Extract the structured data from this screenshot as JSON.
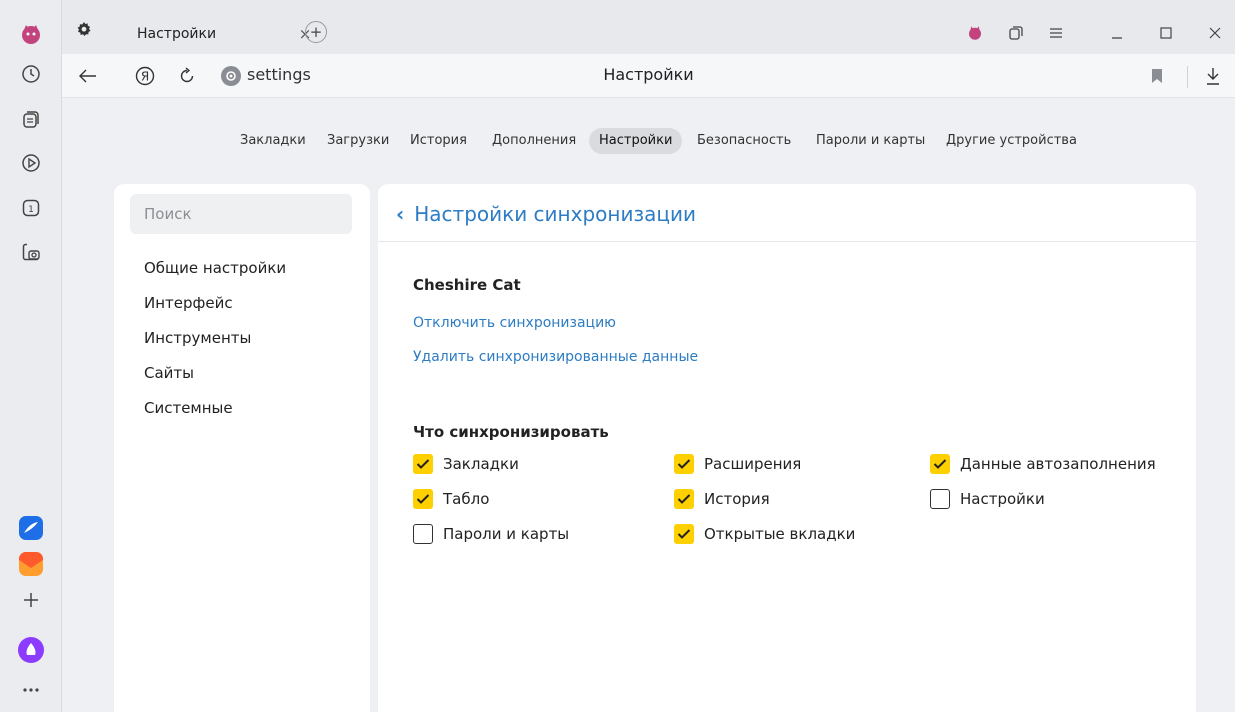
{
  "browser": {
    "tab_title": "Настройки",
    "url": "settings",
    "page_heading": "Настройки"
  },
  "nav": {
    "items": [
      "Закладки",
      "Загрузки",
      "История",
      "Дополнения",
      "Настройки",
      "Безопасность",
      "Пароли и карты",
      "Другие устройства"
    ],
    "active_index": 4
  },
  "sidebar": {
    "search_placeholder": "Поиск",
    "items": [
      "Общие настройки",
      "Интерфейс",
      "Инструменты",
      "Сайты",
      "Системные"
    ]
  },
  "main": {
    "back_title": "Настройки синхронизации",
    "user_name": "Cheshire Cat",
    "disable_sync_link": "Отключить синхронизацию",
    "delete_data_link": "Удалить синхронизированные данные",
    "section_title": "Что синхронизировать",
    "checkboxes": [
      {
        "label": "Закладки",
        "checked": true
      },
      {
        "label": "Расширения",
        "checked": true
      },
      {
        "label": "Данные автозаполнения",
        "checked": true
      },
      {
        "label": "Табло",
        "checked": true
      },
      {
        "label": "История",
        "checked": true
      },
      {
        "label": "Настройки",
        "checked": false
      },
      {
        "label": "Пароли и карты",
        "checked": false
      },
      {
        "label": "Открытые вкладки",
        "checked": true
      }
    ]
  },
  "colors": {
    "accent_link": "#2d7cc4",
    "checkbox_on": "#ffd000"
  }
}
